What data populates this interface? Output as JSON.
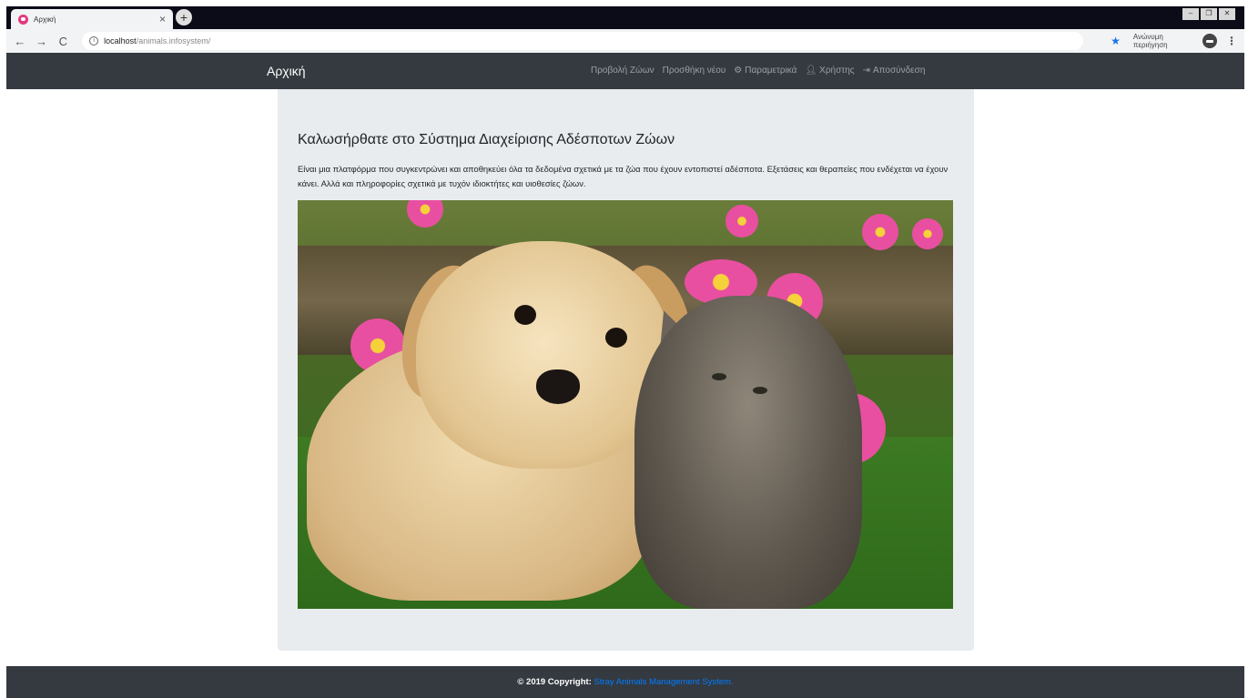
{
  "browser": {
    "tab_title": "Αρχική",
    "tab_close": "×",
    "new_tab": "+",
    "url_host": "localhost",
    "url_path": "/animals.infosystem/",
    "incognito_label": "Ανώνυμη περιήγηση",
    "window_controls": [
      "–",
      "❐",
      "✕"
    ]
  },
  "navbar": {
    "brand": "Αρχική",
    "links": [
      {
        "label": "Προβολή Ζώων",
        "icon": ""
      },
      {
        "label": "Προσθήκη νέου",
        "icon": ""
      },
      {
        "label": "Παραμετρικά",
        "icon": "gears-icon"
      },
      {
        "label": "Χρήστης",
        "icon": "user-icon"
      },
      {
        "label": "Αποσύνδεση",
        "icon": "sign-out-icon"
      }
    ]
  },
  "main": {
    "title": "Καλωσήρθατε στο Σύστημα Διαχείρισης Αδέσποτων Ζώων",
    "lead": "Είναι μια πλατφόρμα που συγκεντρώνει και αποθηκεύει όλα τα δεδομένα σχετικά με τα ζώα που έχουν εντοπιστεί αδέσποτα. Εξετάσεις και θεραπείες που ενδέχεται να έχουν κάνει. Αλλά και πληροφορίες σχετικά με τυχόν ιδιοκτήτες και υιοθεσίες ζώων.",
    "image_subject": "puppy and kitten photo"
  },
  "footer": {
    "copyright": "© 2019 Copyright:",
    "link": "Stray Animals Management System."
  },
  "colors": {
    "navbar_bg": "#343a40",
    "jumbotron_bg": "#e9ecef",
    "link": "#007bff"
  }
}
